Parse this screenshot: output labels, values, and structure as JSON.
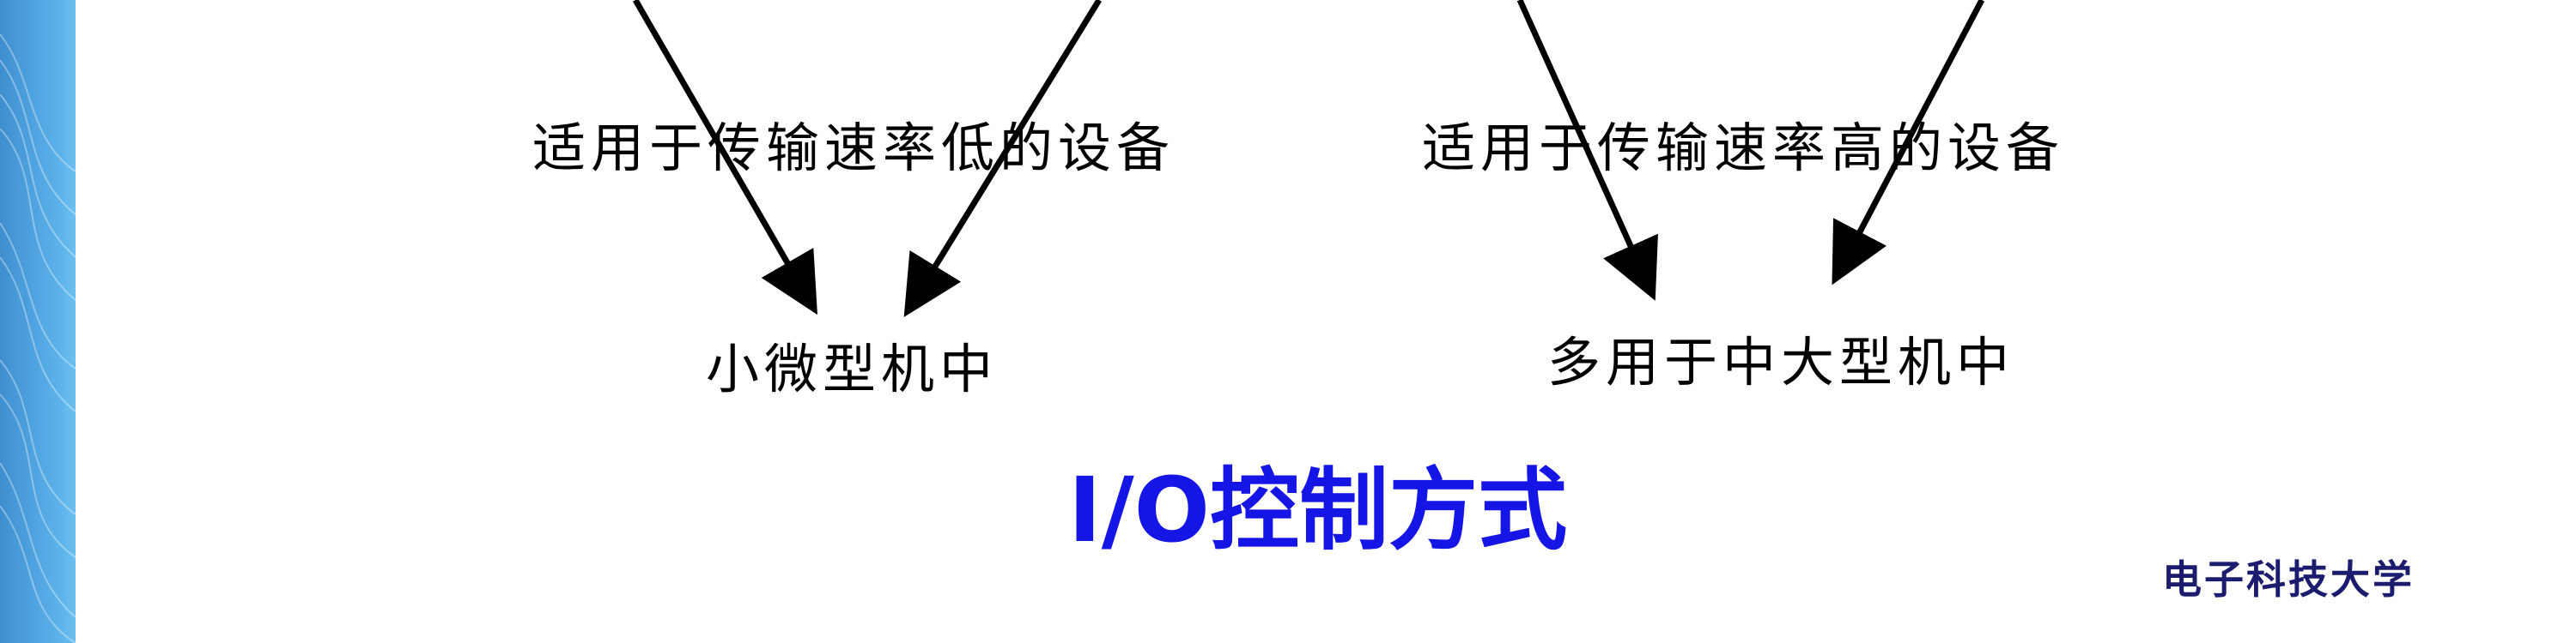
{
  "slide": {
    "label_low_speed": "适用于传输速率低的设备",
    "label_high_speed": "适用于传输速率高的设备",
    "label_small_machines": "小微型机中",
    "label_large_machines": "多用于中大型机中",
    "title": "I/O控制方式",
    "footer": "电子科技大学"
  },
  "colors": {
    "title": "#1515e6",
    "footer": "#1c1c6e",
    "text": "#000000",
    "side_band": "#4fa3e0"
  }
}
